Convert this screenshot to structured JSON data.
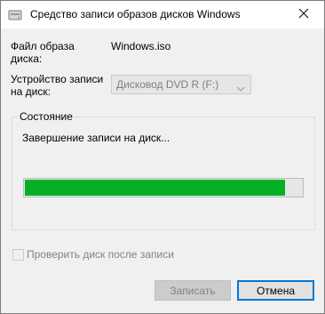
{
  "window": {
    "title": "Средство записи образов дисков Windows",
    "close_glyph": "✕"
  },
  "fields": {
    "image_label": "Файл образа\nдиска:",
    "image_value": "Windows.iso",
    "device_label": "Устройство записи\nна диск:",
    "device_value": "Дисковод DVD R (F:)"
  },
  "status": {
    "group_title": "Состояние",
    "text": "Завершение записи на диск...",
    "progress_fraction": 0.94,
    "progress_color": "#06b025"
  },
  "verify": {
    "label": "Проверить диск после записи",
    "checked": false
  },
  "buttons": {
    "write_label": "Записать",
    "cancel_label": "Отмена"
  },
  "icons": {
    "app": "disc-burner-icon",
    "close": "close-icon",
    "dropdown": "chevron-down-icon"
  }
}
